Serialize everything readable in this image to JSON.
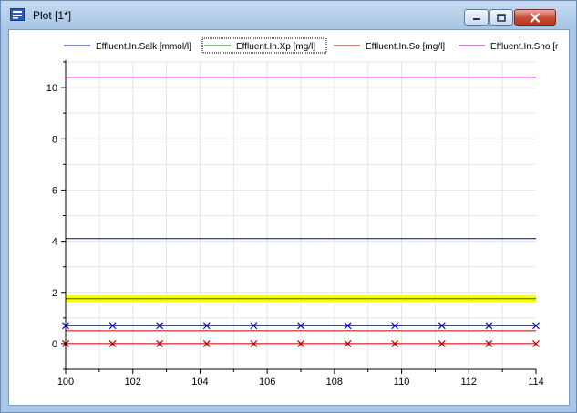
{
  "window": {
    "title": "Plot [1*]",
    "icon": "plot-window-icon",
    "controls": [
      "minimize-icon",
      "maximize-icon",
      "close-icon"
    ]
  },
  "chart_data": {
    "type": "line",
    "xlim": [
      100,
      114
    ],
    "ylim": [
      -1,
      11
    ],
    "x_ticks": [
      100,
      102,
      104,
      106,
      108,
      110,
      112,
      114
    ],
    "y_ticks": [
      0,
      2,
      4,
      6,
      8,
      10
    ],
    "grid": true,
    "legend_placement": "top",
    "series": [
      {
        "name": "Effluent.In.Salk [mmol/l]",
        "color": "#0000c0",
        "x": [
          100,
          114
        ],
        "y": [
          4.1,
          4.1
        ],
        "selected": false
      },
      {
        "name": "Effluent.In.Xp [mg/l]",
        "color": "#008000",
        "x": [
          100,
          114
        ],
        "y": [
          1.75,
          1.75
        ],
        "selected": true,
        "highlight_color": "#ffff00"
      },
      {
        "name": "Effluent.In.So [mg/l]",
        "color": "#c00000",
        "x": [
          100,
          114
        ],
        "y": [
          0.5,
          0.5
        ],
        "selected": false
      },
      {
        "name": "Effluent.In.Sno [r",
        "color": "#c000c0",
        "x": [
          100,
          114
        ],
        "y": [
          10.4,
          10.4
        ],
        "selected": false
      }
    ],
    "extra_lines": [
      {
        "color": "#0000c0",
        "y": 0.7,
        "marker": "x",
        "marker_x": [
          100,
          101.4,
          102.8,
          104.2,
          105.6,
          107,
          108.4,
          109.8,
          111.2,
          112.6,
          114
        ]
      },
      {
        "color": "#c00000",
        "y": 0.0,
        "marker": "x",
        "marker_x": [
          100,
          101.4,
          102.8,
          104.2,
          105.6,
          107,
          108.4,
          109.8,
          111.2,
          112.6,
          114
        ]
      }
    ]
  }
}
